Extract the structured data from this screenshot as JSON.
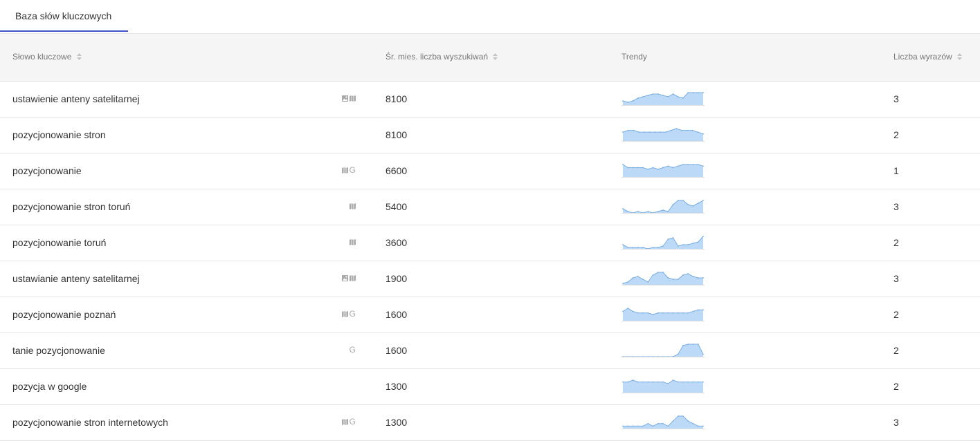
{
  "tabs": [
    {
      "label": "Baza słów kluczowych",
      "active": true
    }
  ],
  "table": {
    "headers": {
      "keyword": "Słowo kluczowe",
      "volume": "Śr. mies. liczba wyszukiwań",
      "trends": "Trendy",
      "words": "Liczba wyrazów"
    },
    "rows": [
      {
        "keyword": "ustawienie anteny satelitarnej",
        "icons": [
          "image-icon",
          "map-icon"
        ],
        "volume": "8100",
        "trend": [
          3,
          2,
          3,
          5,
          6,
          7,
          8,
          8,
          7,
          6,
          8,
          6,
          5,
          9,
          9,
          9,
          9
        ],
        "words": "3"
      },
      {
        "keyword": "pozycjonowanie stron",
        "icons": [],
        "volume": "8100",
        "trend": [
          5,
          6,
          6,
          5,
          5,
          5,
          5,
          5,
          5,
          6,
          7,
          6,
          6,
          6,
          5,
          4
        ],
        "words": "2"
      },
      {
        "keyword": "pozycjonowanie",
        "icons": [
          "map-icon",
          "google-icon"
        ],
        "volume": "6600",
        "trend": [
          8,
          6,
          6,
          6,
          6,
          5,
          6,
          5,
          6,
          7,
          6,
          7,
          8,
          8,
          8,
          8,
          7
        ],
        "words": "1"
      },
      {
        "keyword": "pozycjonowanie stron toruń",
        "icons": [
          "map-icon"
        ],
        "volume": "5400",
        "trend": [
          3,
          1,
          0,
          1,
          0,
          1,
          0,
          1,
          2,
          1,
          6,
          9,
          9,
          6,
          5,
          7,
          9
        ],
        "words": "3"
      },
      {
        "keyword": "pozycjonowanie toruń",
        "icons": [
          "map-icon"
        ],
        "volume": "3600",
        "trend": [
          3,
          1,
          1,
          1,
          1,
          0,
          1,
          1,
          2,
          7,
          8,
          2,
          3,
          3,
          4,
          5,
          9
        ],
        "words": "2"
      },
      {
        "keyword": "ustawianie anteny satelitarnej",
        "icons": [
          "image-icon",
          "map-icon"
        ],
        "volume": "1900",
        "trend": [
          1,
          2,
          5,
          6,
          4,
          2,
          7,
          9,
          9,
          5,
          4,
          4,
          7,
          8,
          6,
          5,
          5
        ],
        "words": "3"
      },
      {
        "keyword": "pozycjonowanie poznań",
        "icons": [
          "map-icon",
          "google-icon"
        ],
        "volume": "1600",
        "trend": [
          6,
          8,
          6,
          5,
          5,
          5,
          4,
          5,
          5,
          5,
          5,
          5,
          5,
          5,
          6,
          7,
          7
        ],
        "words": "2"
      },
      {
        "keyword": "tanie pozycjonowanie",
        "icons": [
          "google-icon"
        ],
        "volume": "1600",
        "trend": [
          0,
          0,
          0,
          0,
          0,
          0,
          0,
          0,
          0,
          0,
          0,
          2,
          9,
          10,
          10,
          10,
          2
        ],
        "words": "2"
      },
      {
        "keyword": "pozycja w google",
        "icons": [],
        "volume": "1300",
        "trend": [
          6,
          6,
          7,
          6,
          6,
          6,
          6,
          6,
          6,
          5,
          7,
          6,
          6,
          6,
          6,
          6,
          6
        ],
        "words": "2"
      },
      {
        "keyword": "pozycjonowanie stron internetowych",
        "icons": [
          "map-icon",
          "google-icon"
        ],
        "volume": "1300",
        "trend": [
          1,
          1,
          1,
          1,
          1,
          2,
          1,
          2,
          2,
          1,
          3,
          5,
          5,
          3,
          2,
          1,
          1
        ],
        "words": "3"
      }
    ]
  },
  "colors": {
    "tab_underline": "#3f51c7",
    "header_bg": "#f5f5f5",
    "trend_fill": "#bcdaf7",
    "trend_line": "#7aaee0"
  }
}
